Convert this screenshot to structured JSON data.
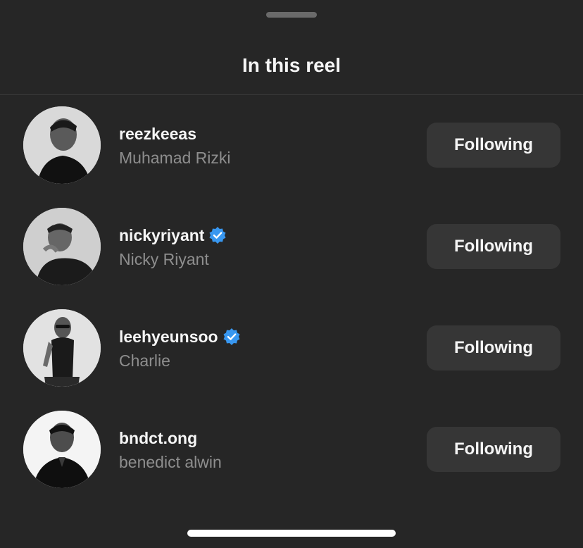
{
  "sheet": {
    "title": "In this reel"
  },
  "people": [
    {
      "username": "reezkeeas",
      "full_name": "Muhamad Rizki",
      "verified": false,
      "button_label": "Following"
    },
    {
      "username": "nickyriyant",
      "full_name": "Nicky Riyant",
      "verified": true,
      "button_label": "Following"
    },
    {
      "username": "leehyeunsoo",
      "full_name": "Charlie",
      "verified": true,
      "button_label": "Following"
    },
    {
      "username": "bndct.ong",
      "full_name": "benedict alwin",
      "verified": false,
      "button_label": "Following"
    }
  ],
  "colors": {
    "background": "#262626",
    "button_bg": "#363636",
    "verified_badge": "#3897f0",
    "secondary_text": "#8e8e8e"
  },
  "icons": {
    "verified": "verified-badge-icon"
  }
}
